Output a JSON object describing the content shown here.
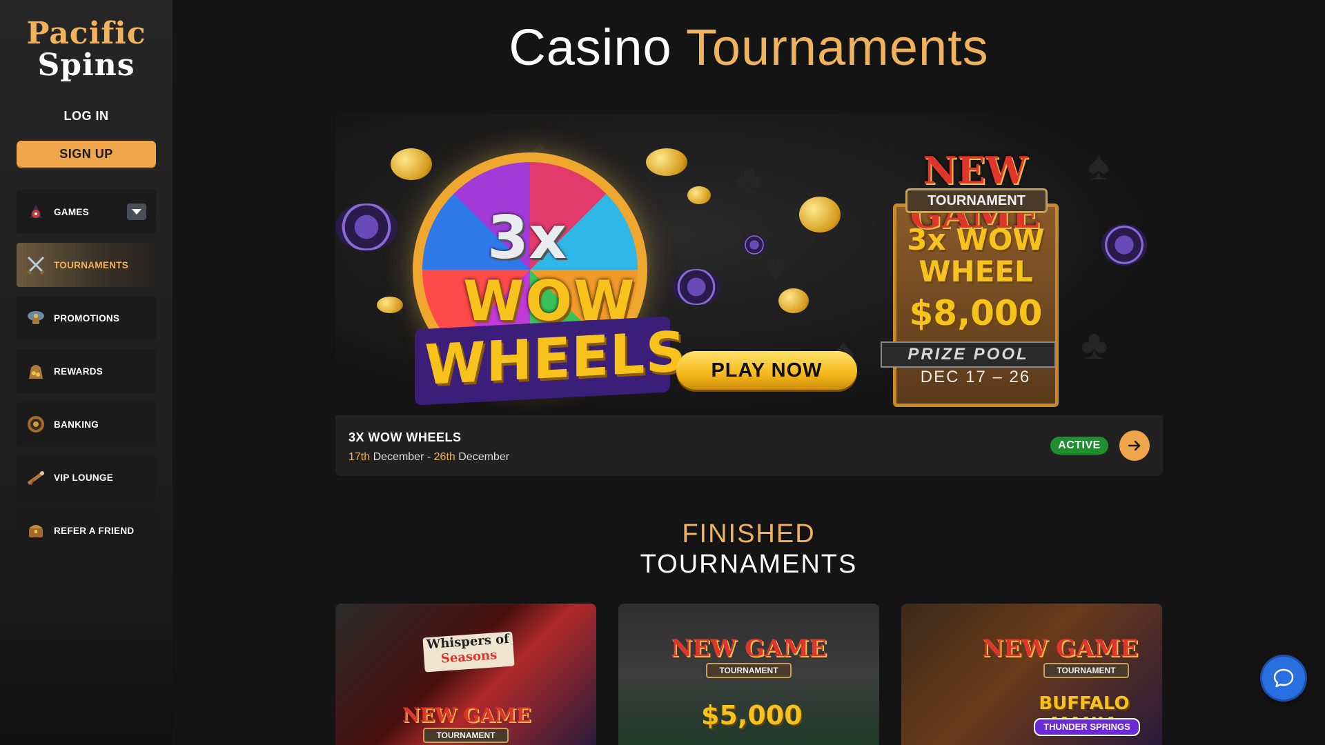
{
  "brand": {
    "line1": "Pacific",
    "line2": "Spins"
  },
  "auth": {
    "login_label": "LOG IN",
    "signup_label": "SIGN UP"
  },
  "sidebar": {
    "items": [
      {
        "label": "GAMES",
        "icon": "games-icon",
        "has_dropdown": true
      },
      {
        "label": "TOURNAMENTS",
        "icon": "crossed-swords-icon",
        "active": true
      },
      {
        "label": "PROMOTIONS",
        "icon": "treasure-map-icon"
      },
      {
        "label": "REWARDS",
        "icon": "treasure-bag-icon"
      },
      {
        "label": "BANKING",
        "icon": "coin-icon"
      },
      {
        "label": "VIP LOUNGE",
        "icon": "spyglass-icon"
      },
      {
        "label": "REFER A FRIEND",
        "icon": "treasure-chest-icon"
      }
    ]
  },
  "page": {
    "title_main": "Casino",
    "title_accent": "Tournaments"
  },
  "featured": {
    "name": "3X WOW WHEELS",
    "start_day": "17th",
    "start_month": "December",
    "separator": "-",
    "end_day": "26th",
    "end_month": "December",
    "status": "ACTIVE",
    "banner": {
      "wheel_3x": "3x",
      "wheel_wow": "WOW",
      "wheel_wheels": "WHEELS",
      "play_label": "PLAY NOW",
      "new_game": "NEW GAME",
      "tournament": "TOURNAMENT",
      "game_line1": "3x WOW",
      "game_line2": "WHEEL",
      "prize": "$8,000",
      "prize_pool": "PRIZE POOL",
      "dates": "DEC 17 – 26"
    }
  },
  "finished": {
    "heading_line1": "FINISHED",
    "heading_line2": "TOURNAMENTS",
    "cards": [
      {
        "title_top": "Whispers of",
        "title_bottom": "Seasons",
        "badge": "NEW GAME",
        "sub": "TOURNAMENT"
      },
      {
        "badge": "NEW GAME",
        "sub": "TOURNAMENT",
        "prize": "$5,000"
      },
      {
        "badge": "NEW GAME",
        "sub": "TOURNAMENT",
        "game": "BUFFALO MANIA",
        "game_sub": "THUNDER SPRINGS"
      }
    ]
  },
  "colors": {
    "accent": "#f0b25b",
    "button": "#f0a54a",
    "active_badge": "#1e8e2e",
    "chat": "#2a6fe0"
  }
}
